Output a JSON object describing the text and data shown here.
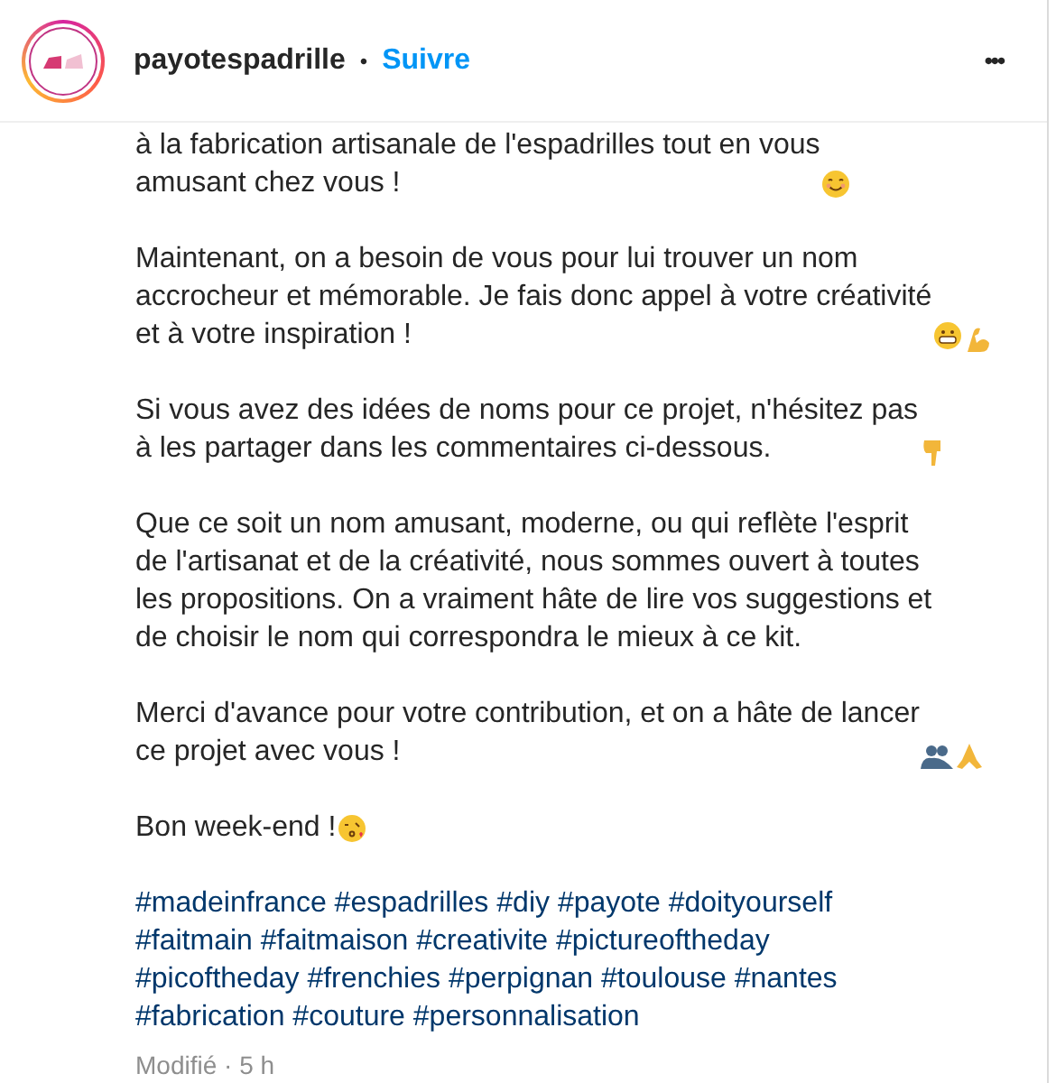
{
  "header": {
    "username": "payotespadrille",
    "separator": "•",
    "follow": "Suivre",
    "more": "•••"
  },
  "paragraphs": [
    {
      "lines": [
        "à la fabrication artisanale de l'espadrilles tout en vous",
        "amusant chez vous !"
      ]
    },
    {
      "lines": [
        "Maintenant, on a besoin de vous pour lui trouver un nom",
        "accrocheur et mémorable. Je fais donc appel à votre créativité",
        "et à votre inspiration !"
      ]
    },
    {
      "lines": [
        "Si vous avez des idées de noms pour ce projet, n'hésitez pas",
        "à les partager dans les commentaires ci-dessous."
      ]
    },
    {
      "lines": [
        "Que ce soit un nom amusant, moderne, ou qui reflète l'esprit",
        "de l'artisanat et de la créativité, nous sommes ouvert à toutes",
        "les propositions. On a vraiment hâte de lire vos suggestions et",
        "de choisir le nom qui correspondra le mieux à ce kit."
      ]
    },
    {
      "lines": [
        "Merci d'avance pour votre contribution, et on a hâte de lancer",
        "ce projet avec vous !"
      ]
    },
    {
      "lines": [
        "Bon week-end !"
      ]
    }
  ],
  "hashtags": [
    "#madeinfrance",
    "#espadrilles",
    "#diy",
    "#payote",
    "#doityourself",
    "#faitmain",
    "#faitmaison",
    "#creativite",
    "#pictureoftheday",
    "#picoftheday",
    "#frenchies",
    "#perpignan",
    "#toulouse",
    "#nantes",
    "#fabrication",
    "#couture",
    "#personnalisation"
  ],
  "timestamp": "Modifié · 5 h"
}
